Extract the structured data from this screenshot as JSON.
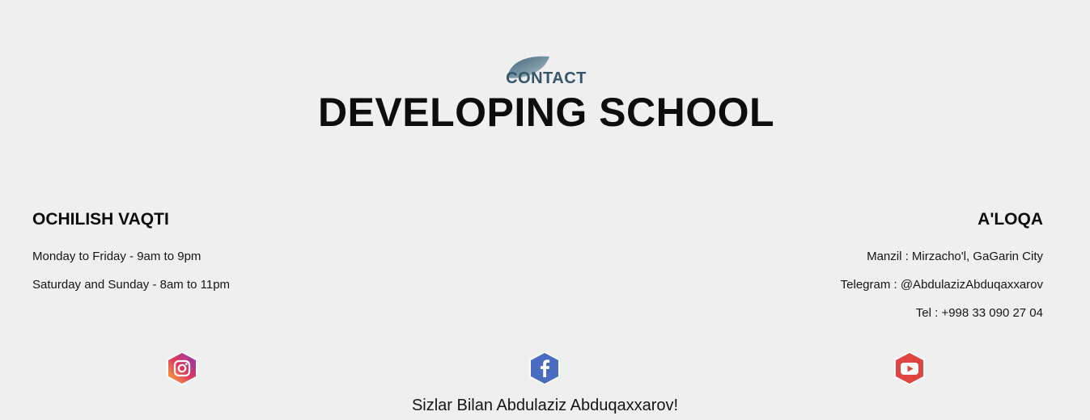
{
  "header": {
    "kicker": "CONTACT",
    "title": "DEVELOPING SCHOOL",
    "leaf_icon": "leaf-icon"
  },
  "hours": {
    "heading": "OCHILISH VAQTI",
    "lines": [
      "Monday to Friday - 9am to 9pm",
      "Saturday and Sunday - 8am to 11pm"
    ]
  },
  "contact": {
    "heading": "A'LOQA",
    "lines": [
      "Manzil : Mirzacho'l, GaGarin City",
      "Telegram : @AbdulazizAbduqaxxarov",
      "Tel : +998 33 090 27 04"
    ]
  },
  "social": {
    "items": [
      {
        "icon": "instagram-icon",
        "color_from": "#f4b13c",
        "color_to": "#8a3ab9"
      },
      {
        "icon": "facebook-icon",
        "color": "#4a6cc0"
      },
      {
        "icon": "youtube-icon",
        "color": "#e0453f"
      }
    ]
  },
  "footer": {
    "text": "Sizlar Bilan Abdulaziz Abduqaxxarov!"
  },
  "colors": {
    "background": "#efefef",
    "accent": "#35566a"
  }
}
